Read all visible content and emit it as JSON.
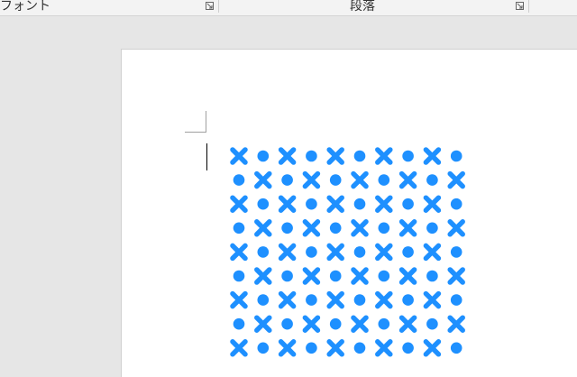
{
  "ribbon": {
    "font_group_label": "フォント",
    "paragraph_group_label": "段落"
  },
  "document": {
    "pattern": {
      "rows": 9,
      "cols": 10,
      "color": "#1e90ff",
      "shapes": [
        "cross",
        "dot"
      ]
    }
  }
}
